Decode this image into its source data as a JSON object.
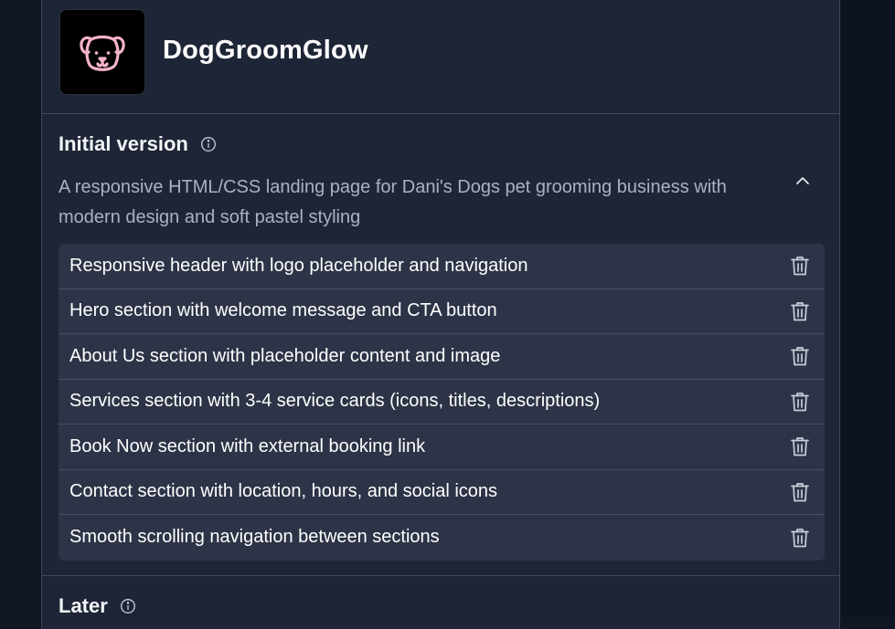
{
  "app": {
    "title": "DogGroomGlow",
    "logo_icon": "dog-face-icon",
    "logo_color": "#f5b3c8"
  },
  "initial_version": {
    "title": "Initial version",
    "description": "A responsive HTML/CSS landing page for Dani's Dogs pet grooming business with modern design and soft pastel styling",
    "features": [
      {
        "label": "Responsive header with logo placeholder and navigation"
      },
      {
        "label": "Hero section with welcome message and CTA button"
      },
      {
        "label": "About Us section with placeholder content and image"
      },
      {
        "label": "Services section with 3-4 service cards (icons, titles, descriptions)"
      },
      {
        "label": "Book Now section with external booking link"
      },
      {
        "label": "Contact section with location, hours, and social icons"
      },
      {
        "label": "Smooth scrolling navigation between sections"
      }
    ]
  },
  "later": {
    "title": "Later"
  }
}
